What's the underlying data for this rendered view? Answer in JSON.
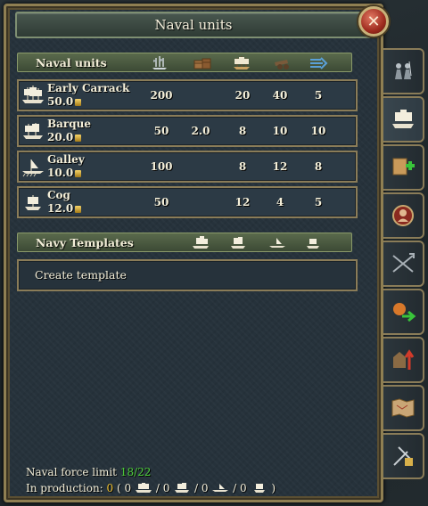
{
  "window": {
    "title": "Naval units"
  },
  "naval_units": {
    "header_label": "Naval units",
    "column_icons": [
      "cannon-ships-icon",
      "cargo-icon",
      "sail-icon",
      "cannon-icon",
      "speed-arrow-icon"
    ],
    "units": [
      {
        "name": "Early Carrack",
        "cost": "50.0",
        "icon": "carrack-icon",
        "stats": [
          "200",
          "",
          "20",
          "40",
          "5"
        ]
      },
      {
        "name": "Barque",
        "cost": "20.0",
        "icon": "barque-icon",
        "stats": [
          "50",
          "2.0",
          "8",
          "10",
          "10"
        ]
      },
      {
        "name": "Galley",
        "cost": "10.0",
        "icon": "galley-icon",
        "stats": [
          "100",
          "",
          "8",
          "12",
          "8"
        ]
      },
      {
        "name": "Cog",
        "cost": "12.0",
        "icon": "cog-icon",
        "stats": [
          "50",
          "",
          "12",
          "4",
          "5"
        ]
      }
    ]
  },
  "templates": {
    "header_label": "Navy Templates",
    "create_label": "Create template"
  },
  "footer": {
    "force_limit_label": "Naval force limit",
    "force_limit_value": "18/22",
    "production_label": "In production:",
    "production_total": "0",
    "paren_open": "(",
    "paren_close": ")",
    "counts": [
      "0",
      "0",
      "0",
      "0"
    ],
    "separator": "/"
  },
  "side_tabs": [
    "army-tab-icon",
    "navy-tab-icon",
    "recruit-tab-icon",
    "leader-tab-icon",
    "rebels-tab-icon",
    "mercenary-tab-icon",
    "buildings-tab-icon",
    "map-tab-icon",
    "military-tech-tab-icon"
  ],
  "colors": {
    "accent_green": "#4fcf3a",
    "gold": "#f1c232",
    "frame": "#8f7f52"
  }
}
